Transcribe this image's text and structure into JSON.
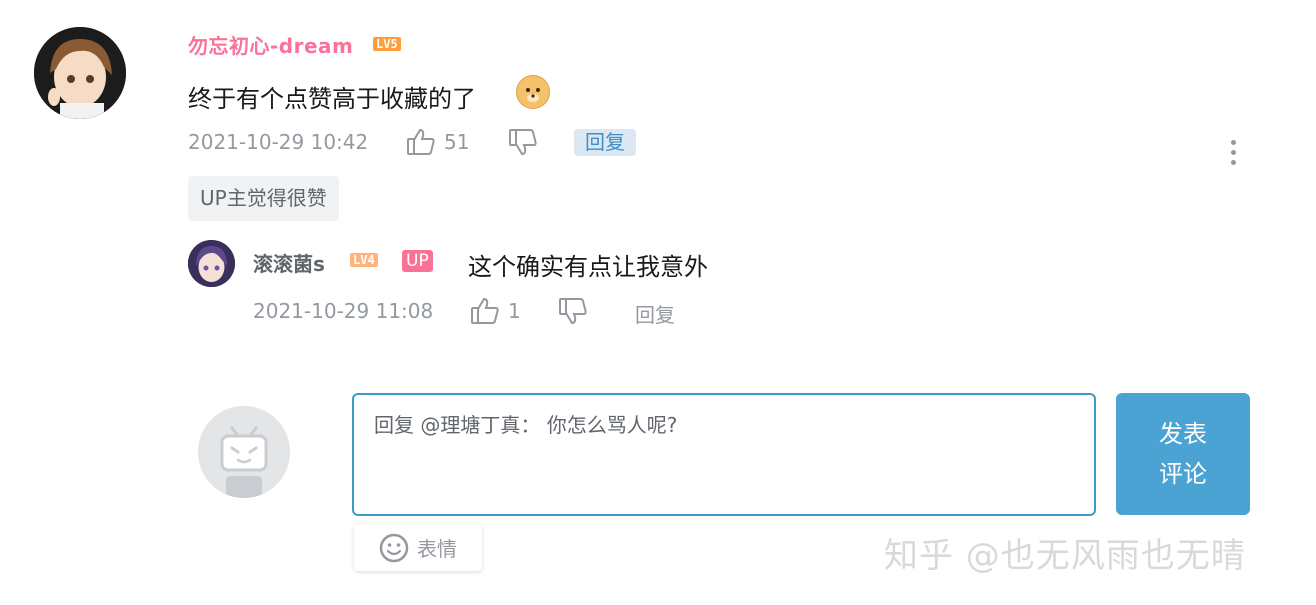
{
  "comment": {
    "username": "勿忘初心-dream",
    "level": "LV5",
    "text": "终于有个点赞高于收藏的了",
    "emoji": "doge-emoji",
    "date": "2021-10-29 10:42",
    "likes": "51",
    "reply_label": "回复",
    "up_tag": "UP主觉得很赞"
  },
  "reply": {
    "username": "滚滚菌s",
    "level": "LV4",
    "up_badge": "UP",
    "text": "这个确实有点让我意外",
    "date": "2021-10-29 11:08",
    "likes": "1",
    "reply_label": "回复"
  },
  "composer": {
    "value": "回复 @理塘丁真： 你怎么骂人呢?",
    "submit_line1": "发表",
    "submit_line2": "评论",
    "emoji_label": "表情"
  },
  "watermark": "知乎 @也无风雨也无晴",
  "colors": {
    "username_pink": "#fb7299",
    "accent_blue": "#4ba3d3",
    "muted_gray": "#9499a0"
  }
}
